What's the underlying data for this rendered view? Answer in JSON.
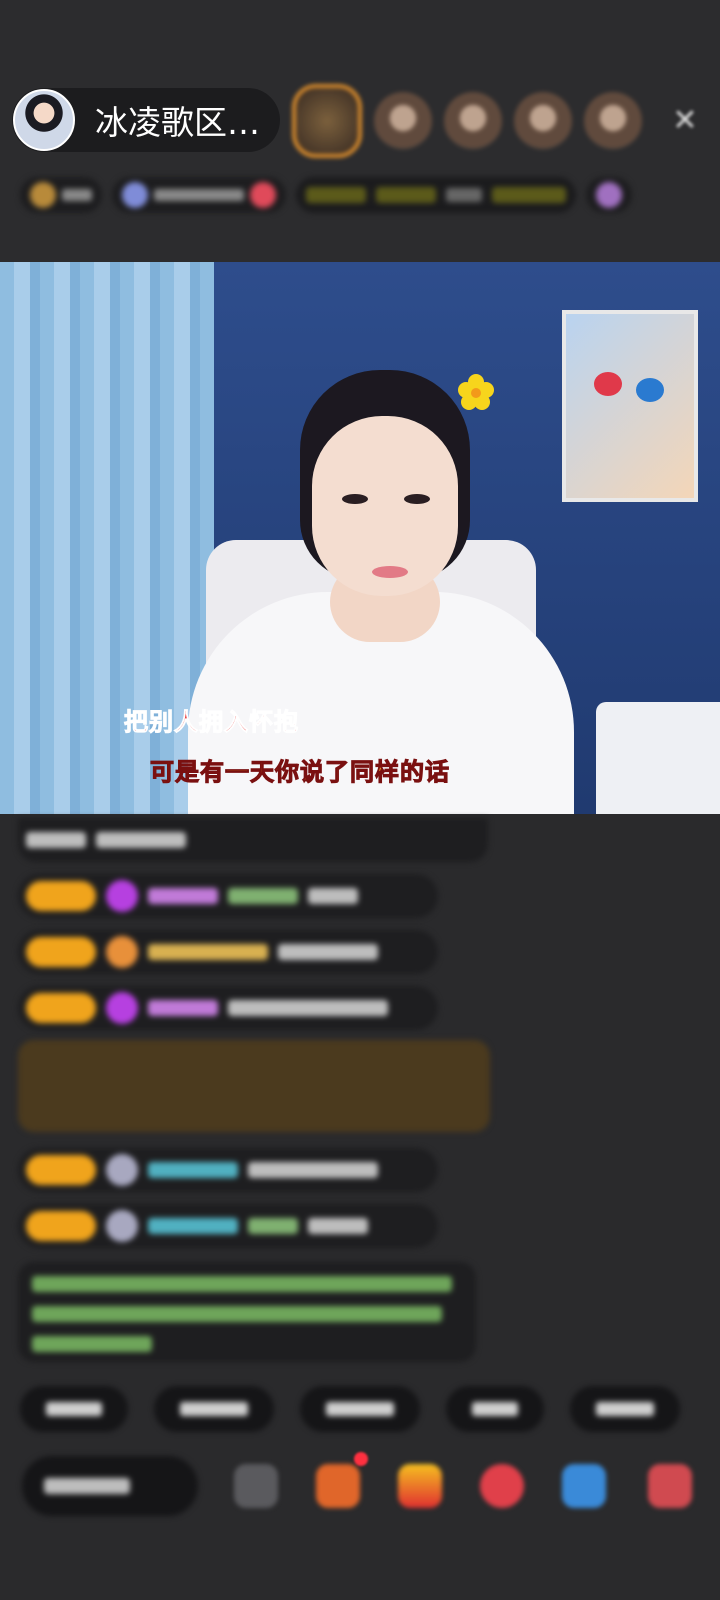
{
  "header": {
    "anchor_name": "冰凌歌区…",
    "viewers": [
      "viewer-1",
      "viewer-2",
      "viewer-3",
      "viewer-4",
      "viewer-5"
    ],
    "close_icon": "close-icon"
  },
  "video": {
    "lyric_line_1": "把别人拥入怀抱",
    "lyric_line_2": "可是有一天你说了同样的话"
  },
  "colors": {
    "level_badge": "#f0a41c",
    "gold_message_bg": "#4b3a1e",
    "system_text": "#6ea55a",
    "lyric_red": "#e52222",
    "lyric_orange": "#f0a020"
  },
  "icons": [
    "close-icon",
    "flower-sticker-icon",
    "emoji-icon",
    "gift-box-icon",
    "gift-icon",
    "lipstick-gift-icon",
    "game-icon",
    "more-gift-icon"
  ]
}
